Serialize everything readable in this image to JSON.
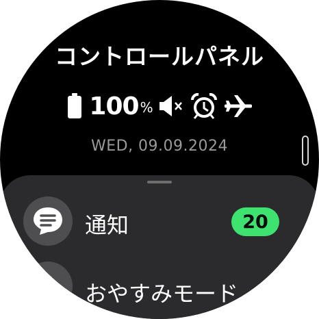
{
  "header": {
    "title": "コントロールパネル"
  },
  "status": {
    "battery_level": "100",
    "battery_unit": "%",
    "icons": [
      "battery-full-icon",
      "sound-muted-icon",
      "alarm-icon",
      "airplane-mode-icon"
    ],
    "date": "WED, 09.09.2024"
  },
  "panel": {
    "items": [
      {
        "label": "通知",
        "icon": "message-icon",
        "badge": "20"
      },
      {
        "label": "おやすみモード",
        "icon": "moon-icon"
      }
    ]
  },
  "colors": {
    "background": "#000000",
    "panel": "#2b2b2d",
    "badge": "#3ee26f",
    "date_text": "#9a9a9a"
  }
}
